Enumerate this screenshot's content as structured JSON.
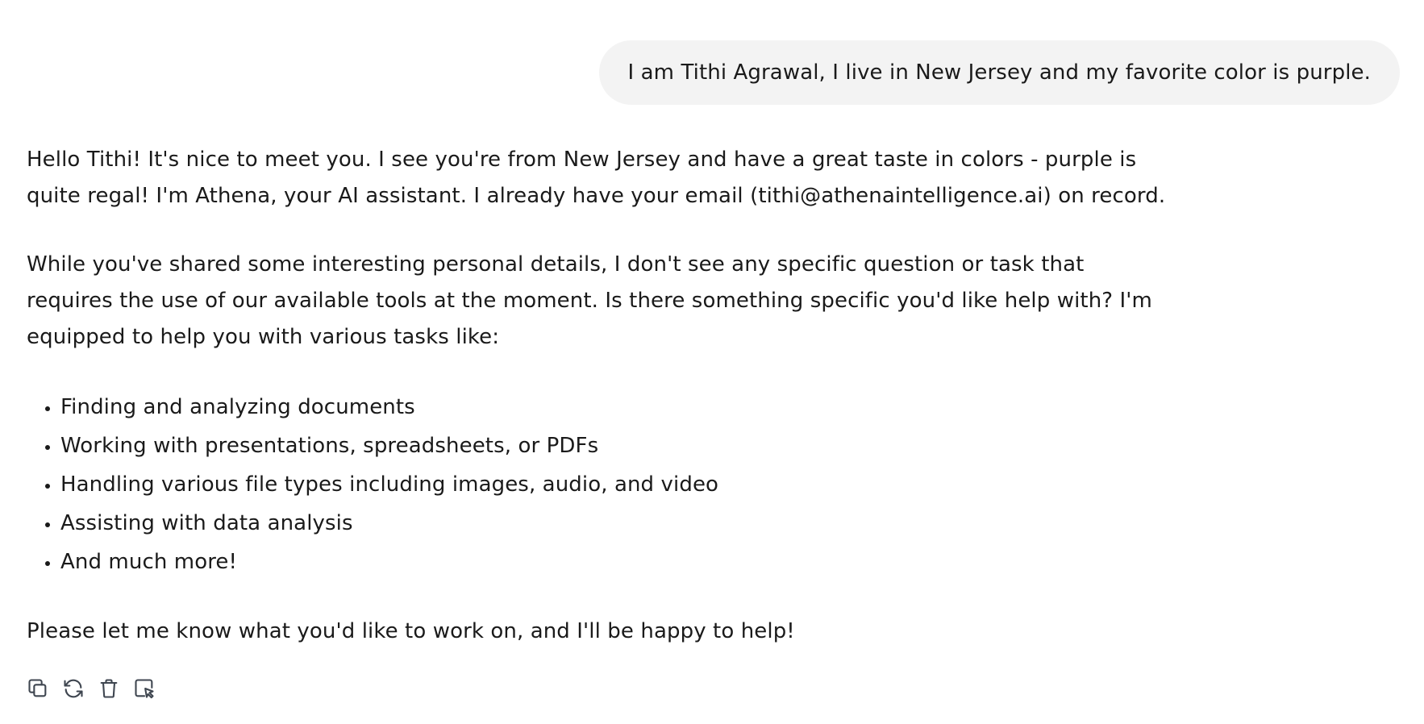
{
  "user_message": {
    "text": "I am Tithi Agrawal, I live in New Jersey and my favorite color is purple."
  },
  "assistant_message": {
    "paragraph_1": "Hello Tithi! It's nice to meet you. I see you're from New Jersey and have a great taste in colors - purple is quite regal! I'm Athena, your AI assistant. I already have your email (tithi@athenaintelligence.ai) on record.",
    "paragraph_2": "While you've shared some interesting personal details, I don't see any specific question or task that requires the use of our available tools at the moment. Is there something specific you'd like help with? I'm equipped to help you with various tasks like:",
    "list_items": [
      "Finding and analyzing documents",
      "Working with presentations, spreadsheets, or PDFs",
      "Handling various file types including images, audio, and video",
      "Assisting with data analysis",
      "And much more!"
    ],
    "paragraph_3": "Please let me know what you'd like to work on, and I'll be happy to help!"
  },
  "actions": [
    {
      "icon": "copy-icon"
    },
    {
      "icon": "refresh-icon"
    },
    {
      "icon": "trash-icon"
    },
    {
      "icon": "cursor-select-icon"
    }
  ],
  "colors": {
    "user_bubble_bg": "#f3f3f3",
    "text": "#1a1a1a",
    "icon": "#3f4650"
  }
}
